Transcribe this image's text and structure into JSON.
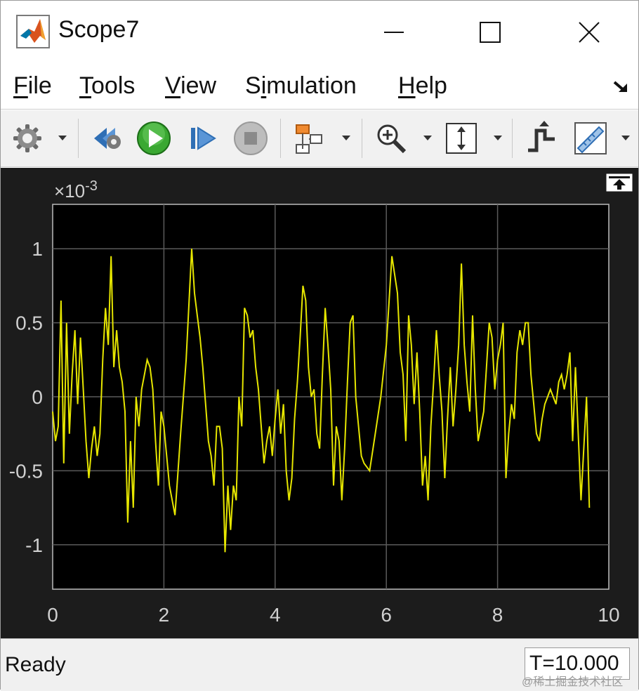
{
  "window": {
    "title": "Scope7"
  },
  "menu": {
    "items": [
      {
        "accel": "F",
        "rest": "ile",
        "pre": ""
      },
      {
        "accel": "T",
        "rest": "ools",
        "pre": ""
      },
      {
        "accel": "V",
        "rest": "iew",
        "pre": ""
      },
      {
        "accel": "i",
        "rest": "mulation",
        "pre": "S"
      },
      {
        "accel": "H",
        "rest": "elp",
        "pre": ""
      }
    ]
  },
  "toolbar": {
    "icons": [
      "gear-icon",
      "step-back-icon",
      "run-icon",
      "step-forward-icon",
      "stop-icon",
      "highlight-block-icon",
      "zoom-icon",
      "fit-icon",
      "triggers-icon",
      "measurements-icon"
    ]
  },
  "chart_data": {
    "type": "line",
    "exponent_label": "×10",
    "exponent_sup": "-3",
    "xlim": [
      0,
      10
    ],
    "ylim": [
      -1.3,
      1.3
    ],
    "xticks": [
      0,
      2,
      4,
      6,
      8,
      10
    ],
    "xtick_labels": [
      "0",
      "2",
      "4",
      "6",
      "8",
      "10"
    ],
    "yticks": [
      -1,
      -0.5,
      0,
      0.5,
      1
    ],
    "ytick_labels": [
      "-1",
      "-0.5",
      "0",
      "0.5",
      "1"
    ],
    "grid": true,
    "line_color": "#e6e600",
    "background": "#000000",
    "x": [
      0.0,
      0.05,
      0.1,
      0.15,
      0.2,
      0.25,
      0.3,
      0.35,
      0.4,
      0.45,
      0.5,
      0.55,
      0.6,
      0.65,
      0.7,
      0.75,
      0.8,
      0.85,
      0.9,
      0.95,
      1.0,
      1.05,
      1.1,
      1.15,
      1.2,
      1.25,
      1.3,
      1.35,
      1.4,
      1.45,
      1.5,
      1.55,
      1.6,
      1.65,
      1.7,
      1.75,
      1.8,
      1.85,
      1.9,
      1.95,
      2.0,
      2.1,
      2.2,
      2.3,
      2.4,
      2.5,
      2.55,
      2.6,
      2.65,
      2.7,
      2.75,
      2.8,
      2.85,
      2.9,
      2.95,
      3.0,
      3.05,
      3.1,
      3.15,
      3.2,
      3.25,
      3.3,
      3.35,
      3.4,
      3.45,
      3.5,
      3.55,
      3.6,
      3.65,
      3.7,
      3.75,
      3.8,
      3.85,
      3.9,
      3.95,
      4.0,
      4.05,
      4.1,
      4.15,
      4.2,
      4.25,
      4.3,
      4.35,
      4.4,
      4.45,
      4.5,
      4.55,
      4.6,
      4.65,
      4.7,
      4.75,
      4.8,
      4.85,
      4.9,
      4.95,
      5.0,
      5.05,
      5.1,
      5.15,
      5.2,
      5.25,
      5.3,
      5.35,
      5.4,
      5.45,
      5.5,
      5.55,
      5.6,
      5.7,
      5.8,
      5.9,
      6.0,
      6.1,
      6.2,
      6.25,
      6.3,
      6.35,
      6.4,
      6.45,
      6.5,
      6.55,
      6.6,
      6.65,
      6.7,
      6.75,
      6.8,
      6.85,
      6.9,
      6.95,
      7.0,
      7.05,
      7.1,
      7.15,
      7.2,
      7.25,
      7.3,
      7.35,
      7.4,
      7.45,
      7.5,
      7.55,
      7.6,
      7.65,
      7.7,
      7.75,
      7.8,
      7.85,
      7.9,
      7.95,
      8.0,
      8.05,
      8.1,
      8.15,
      8.2,
      8.25,
      8.3,
      8.35,
      8.4,
      8.45,
      8.5,
      8.55,
      8.6,
      8.65,
      8.7,
      8.75,
      8.8,
      8.85,
      8.9,
      8.95,
      9.0,
      9.05,
      9.1,
      9.15,
      9.2,
      9.25,
      9.3,
      9.35,
      9.4,
      9.5,
      9.6,
      9.65,
      9.7,
      9.75,
      9.8,
      9.85,
      9.9,
      9.95,
      10.0
    ],
    "y": [
      -0.1,
      -0.3,
      -0.2,
      0.65,
      -0.45,
      0.5,
      -0.25,
      0.15,
      0.45,
      -0.05,
      0.4,
      0.05,
      -0.3,
      -0.55,
      -0.35,
      -0.2,
      -0.4,
      -0.25,
      0.25,
      0.6,
      0.35,
      0.95,
      0.2,
      0.45,
      0.2,
      0.1,
      -0.1,
      -0.85,
      -0.3,
      -0.75,
      0.0,
      -0.2,
      0.05,
      0.15,
      0.25,
      0.2,
      0.05,
      -0.3,
      -0.6,
      -0.1,
      -0.2,
      -0.6,
      -0.8,
      -0.25,
      0.25,
      1.0,
      0.7,
      0.55,
      0.4,
      0.2,
      -0.05,
      -0.3,
      -0.4,
      -0.6,
      -0.2,
      -0.2,
      -0.35,
      -1.05,
      -0.6,
      -0.9,
      -0.6,
      -0.7,
      0.0,
      -0.2,
      0.6,
      0.55,
      0.4,
      0.45,
      0.2,
      0.05,
      -0.2,
      -0.45,
      -0.3,
      -0.2,
      -0.4,
      -0.15,
      0.05,
      -0.25,
      -0.05,
      -0.5,
      -0.7,
      -0.55,
      -0.15,
      0.1,
      0.4,
      0.75,
      0.65,
      0.2,
      0.0,
      0.05,
      -0.25,
      -0.35,
      0.15,
      0.6,
      0.35,
      0.05,
      -0.6,
      -0.2,
      -0.3,
      -0.7,
      -0.35,
      0.1,
      0.5,
      0.55,
      0.0,
      -0.2,
      -0.4,
      -0.45,
      -0.5,
      -0.25,
      0.0,
      0.35,
      0.95,
      0.7,
      0.3,
      0.15,
      -0.3,
      0.55,
      0.35,
      -0.05,
      0.3,
      -0.1,
      -0.6,
      -0.4,
      -0.7,
      -0.2,
      0.1,
      0.45,
      0.15,
      -0.1,
      -0.55,
      -0.15,
      0.2,
      -0.2,
      0.05,
      0.35,
      0.9,
      0.35,
      0.1,
      -0.1,
      0.55,
      0.05,
      -0.3,
      -0.2,
      -0.1,
      0.2,
      0.5,
      0.4,
      0.05,
      0.25,
      0.35,
      0.5,
      -0.55,
      -0.25,
      -0.05,
      -0.15,
      0.3,
      0.45,
      0.35,
      0.5,
      0.5,
      0.15,
      -0.05,
      -0.25,
      -0.3,
      -0.15,
      -0.05,
      0.0,
      0.05,
      0.0,
      -0.05,
      0.1,
      0.15,
      0.05,
      0.15,
      0.3,
      -0.3,
      0.2,
      -0.7,
      0.0,
      -0.75
    ]
  },
  "status": {
    "text": "Ready",
    "time": "T=10.000"
  },
  "watermark": "@稀土掘金技术社区"
}
